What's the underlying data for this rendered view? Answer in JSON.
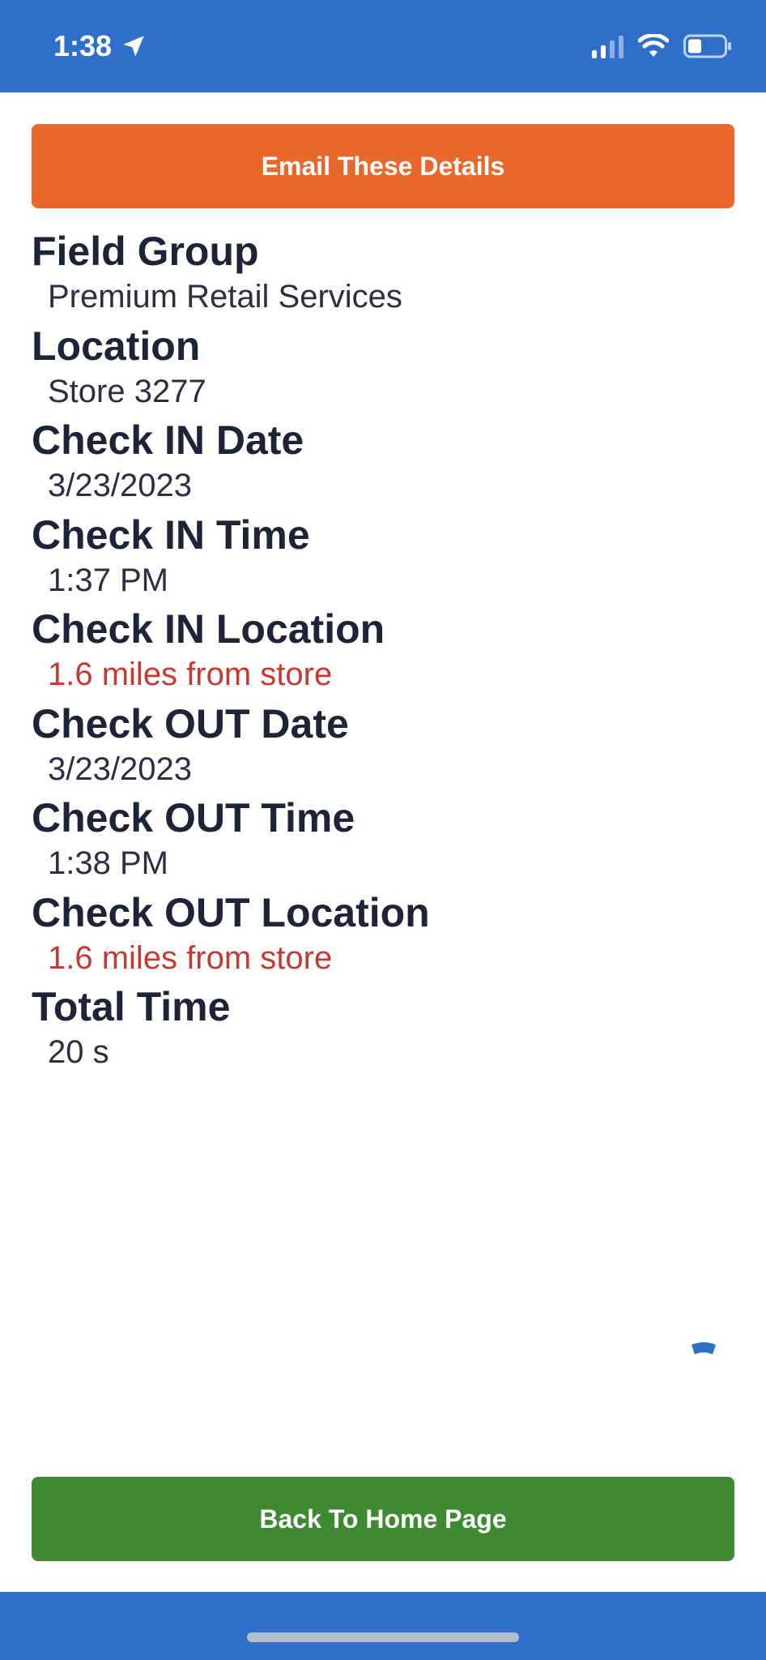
{
  "status_bar": {
    "time": "1:38",
    "icons": [
      "location-arrow-icon",
      "cellular-signal-icon",
      "wifi-icon",
      "battery-icon"
    ]
  },
  "actions": {
    "email_label": "Email These Details",
    "home_label": "Back To Home Page"
  },
  "details": [
    {
      "label": "Field Group",
      "value": "Premium Retail Services",
      "warning": false
    },
    {
      "label": "Location",
      "value": "Store 3277",
      "warning": false
    },
    {
      "label": "Check IN Date",
      "value": "3/23/2023",
      "warning": false
    },
    {
      "label": "Check IN Time",
      "value": "1:37 PM",
      "warning": false
    },
    {
      "label": "Check IN Location",
      "value": "1.6 miles from store",
      "warning": true
    },
    {
      "label": "Check OUT Date",
      "value": "3/23/2023",
      "warning": false
    },
    {
      "label": "Check OUT Time",
      "value": "1:38 PM",
      "warning": false
    },
    {
      "label": "Check OUT Location",
      "value": "1.6 miles from store",
      "warning": true
    },
    {
      "label": "Total Time",
      "value": "20 s",
      "warning": false
    }
  ],
  "colors": {
    "header_blue": "#2f6fc9",
    "email_orange": "#e8692b",
    "home_green": "#3d8a31",
    "warning_red": "#c43a32",
    "label_dark": "#1d2438"
  }
}
